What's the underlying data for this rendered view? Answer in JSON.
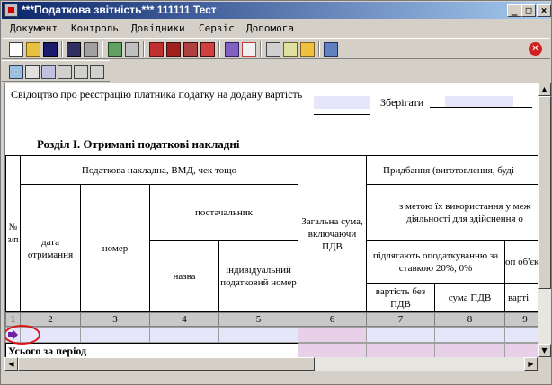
{
  "window": {
    "title": "***Податкова звітність*** 111111 Тест",
    "minimize": "_",
    "maximize": "□",
    "close": "×"
  },
  "menu": [
    "Документ",
    "Контроль",
    "Довідники",
    "Сервіс",
    "Допомога"
  ],
  "toolbar_icons": [
    "new-document-icon",
    "open-folder-icon",
    "save-icon",
    "save-all-icon",
    "print-icon",
    "search-icon",
    "calculator-icon",
    "home-icon",
    "books-icon",
    "copy-icon",
    "export-icon",
    "edit-icon",
    "report-icon",
    "settings-icon",
    "table-icon",
    "tax-icon",
    "exit-icon",
    "close-icon"
  ],
  "toolbar2_icons": [
    "copy-row-icon",
    "cut-icon",
    "paste-icon",
    "insert-row-icon",
    "add-row-icon",
    "delete-row-icon"
  ],
  "document": {
    "certificate_label": "Свідоцтво про реєстрацію платника податку на додану вартість",
    "save_label": "Зберігати",
    "section_title": "Розділ І. Отримані податкові накладні",
    "headers": {
      "rownum": "№ з/п",
      "invoice": "Податкова накладна, ВМД, чек тощо",
      "received_date": "дата отримання",
      "number": "номер",
      "supplier": "постачальник",
      "name": "назва",
      "tax_id": "індивідуальний податковий номер",
      "total": "Загальна сума, включаючи ПДВ",
      "purchase": "Придбання (виготовлення, буді",
      "purpose": "з метою їх використання у меж діяльності для здійснення о",
      "taxable": "підлягають оподаткуванню за ставкою 20%, 0%",
      "partial": "оп об'єкт",
      "cost_no_vat": "вартість без ПДВ",
      "vat_sum": "сума ПДВ",
      "cost_partial": "варті"
    },
    "column_numbers": [
      "1",
      "2",
      "3",
      "4",
      "5",
      "6",
      "7",
      "8",
      "9"
    ],
    "total_label": "Усього за період"
  },
  "colors": {
    "title_start": "#0a246a",
    "title_end": "#a6caf0",
    "input_cell": "#e6e6fa",
    "pink_cell": "#e8d0e8",
    "marker": "#e01010",
    "row_arrow": "#7020a0"
  }
}
